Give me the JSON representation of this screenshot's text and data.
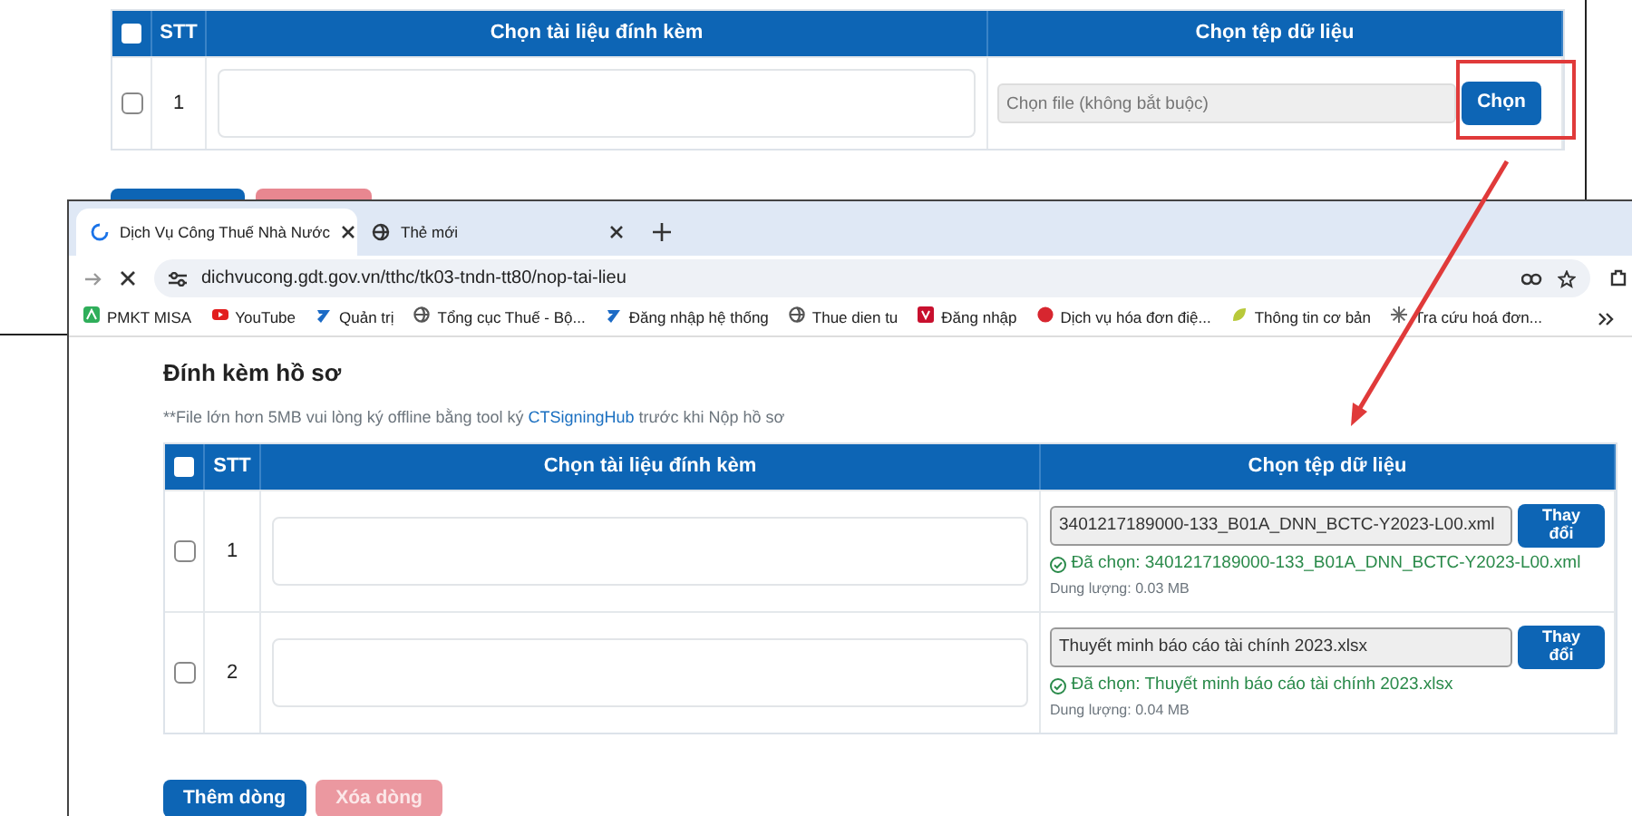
{
  "background_window": {
    "table": {
      "header_checkbox": {
        "checked": false
      },
      "columns": [
        "STT",
        "Chọn tài liệu đính kèm",
        "Chọn tệp dữ liệu"
      ],
      "rows": [
        {
          "checked": false,
          "stt": "1",
          "file_placeholder": "Chọn file (không bắt buộc)",
          "button": "Chọn"
        }
      ]
    },
    "buttons": [
      {
        "kind": "primary"
      },
      {
        "kind": "danger"
      }
    ]
  },
  "browser": {
    "tabs": [
      {
        "label": "Dịch Vụ Công Thuế Nhà Nước",
        "selected": true,
        "loading": true
      },
      {
        "label": "Thẻ mới",
        "selected": false,
        "loading": false
      }
    ],
    "address": "dichvucong.gdt.gov.vn/tthc/tk03-tndn-tt80/nop-tai-lieu",
    "bookmarks": [
      {
        "label": "PMKT MISA",
        "kind": "app"
      },
      {
        "label": "YouTube",
        "kind": "video"
      },
      {
        "label": "Quản trị",
        "kind": "ribbon"
      },
      {
        "label": "Tổng cục Thuế - Bộ...",
        "kind": "globe"
      },
      {
        "label": "Đăng nhập hệ thống",
        "kind": "ribbon"
      },
      {
        "label": "Thue dien tu",
        "kind": "globe"
      },
      {
        "label": "Đăng nhập",
        "kind": "tile"
      },
      {
        "label": "Dịch vụ hóa đơn điệ...",
        "kind": "circle"
      },
      {
        "label": "Thông tin cơ bản",
        "kind": "leaf"
      },
      {
        "label": "Tra cứu hoá đơn...",
        "kind": "spark"
      }
    ]
  },
  "page": {
    "title": "Đính kèm hồ sơ",
    "note": {
      "before": "**File lớn hơn 5MB vui lòng ký offline bằng tool ký",
      "link": "CTSigningHub",
      "after": "trước khi Nộp hồ sơ"
    },
    "table": {
      "header_checkbox": {
        "checked": false
      },
      "columns": [
        "STT",
        "Chọn tài liệu đính kèm",
        "Chọn tệp dữ liệu"
      ],
      "rows": [
        {
          "checked": false,
          "stt": "1",
          "file": "3401217189000-133_B01A_DNN_BCTC-Y2023-L00.xml",
          "button": "Thay đổi",
          "chosen": "Đã chọn: 3401217189000-133_B01A_DNN_BCTC-Y2023-L00.xml",
          "size": "Dung lượng: 0.03 MB"
        },
        {
          "checked": false,
          "stt": "2",
          "file": "Thuyết minh báo cáo tài chính 2023.xlsx",
          "button": "Thay đổi",
          "chosen": "Đã chọn: Thuyết minh báo cáo tài chính 2023.xlsx",
          "size": "Dung lượng: 0.04 MB"
        }
      ]
    },
    "buttons": [
      {
        "label": "Thêm dòng",
        "kind": "primary",
        "disabled": false
      },
      {
        "label": "Xóa dòng",
        "kind": "danger",
        "disabled": true
      }
    ]
  }
}
